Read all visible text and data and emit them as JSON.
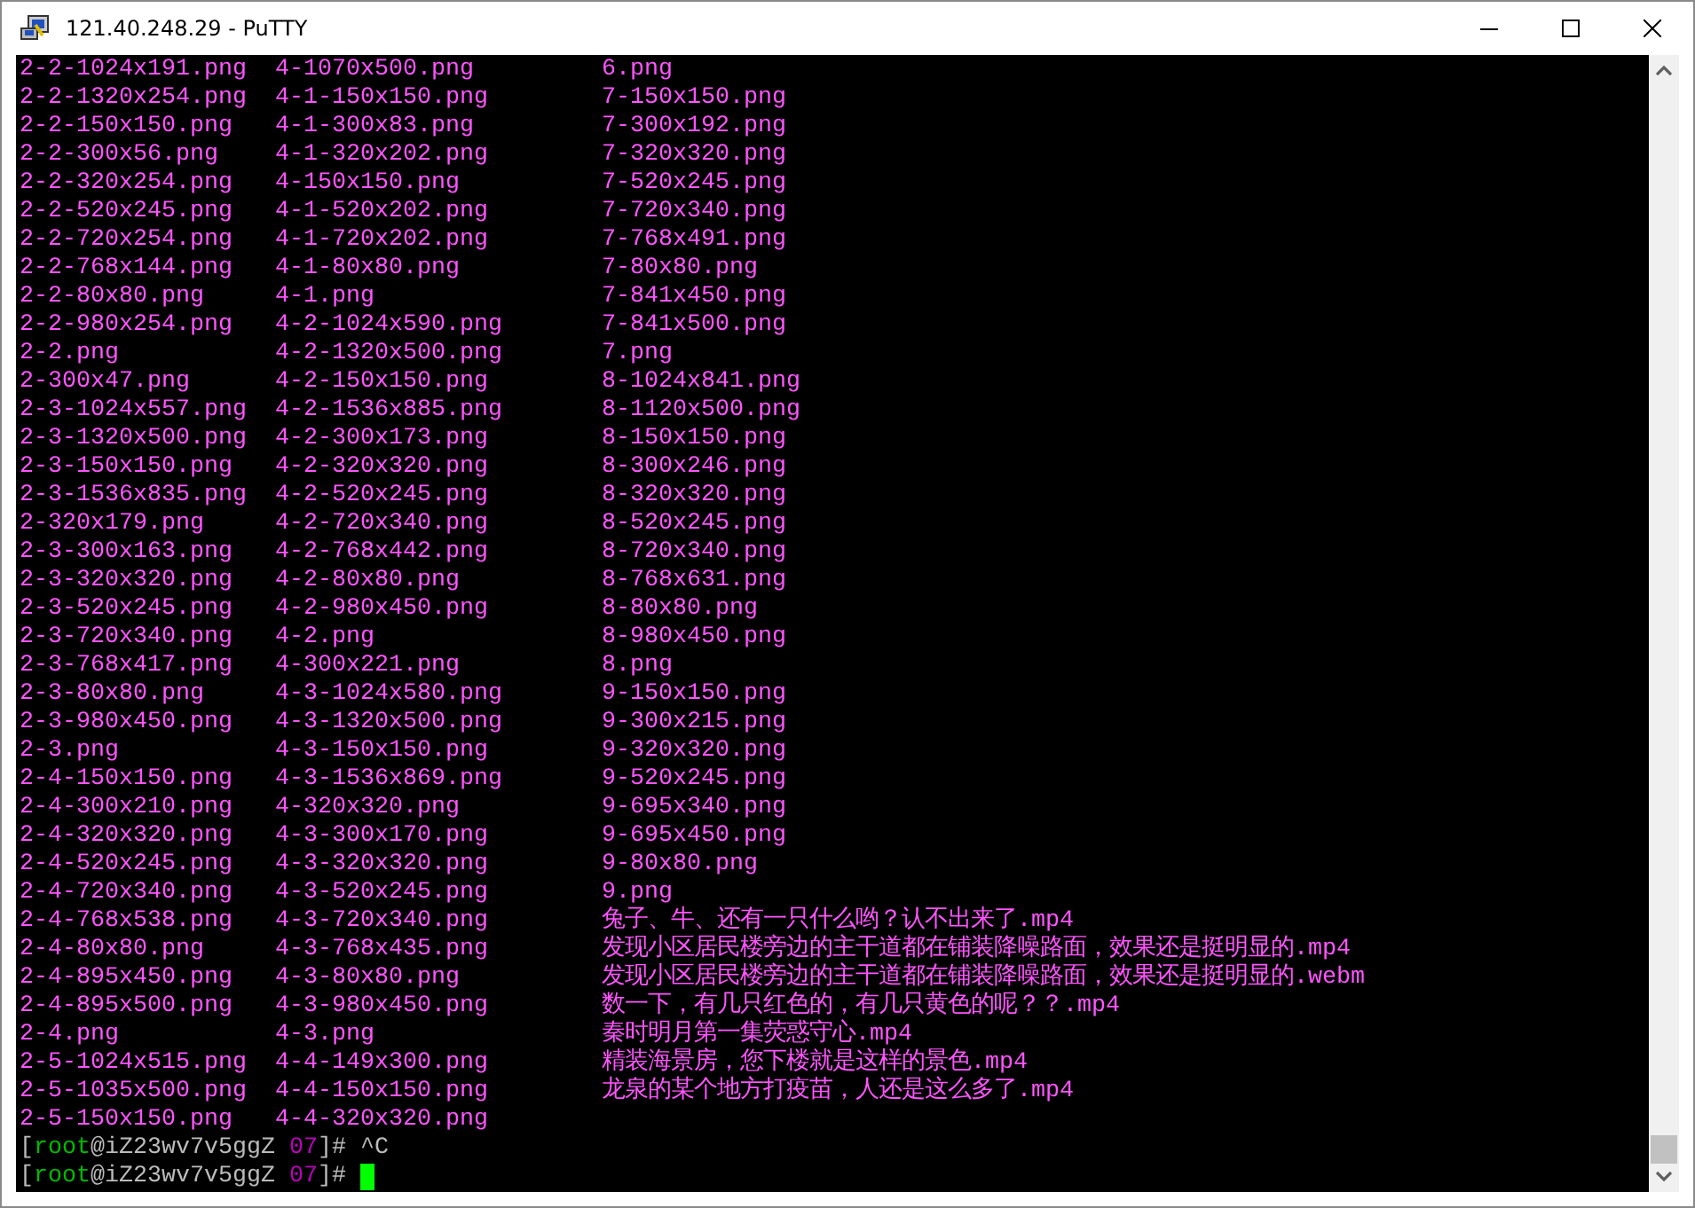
{
  "window": {
    "title": "121.40.248.29 - PuTTY"
  },
  "terminal": {
    "listing": [
      [
        "2-2-1024x191.png",
        "4-1070x500.png",
        "6.png"
      ],
      [
        "2-2-1320x254.png",
        "4-1-150x150.png",
        "7-150x150.png"
      ],
      [
        "2-2-150x150.png",
        "4-1-300x83.png",
        "7-300x192.png"
      ],
      [
        "2-2-300x56.png",
        "4-1-320x202.png",
        "7-320x320.png"
      ],
      [
        "2-2-320x254.png",
        "4-150x150.png",
        "7-520x245.png"
      ],
      [
        "2-2-520x245.png",
        "4-1-520x202.png",
        "7-720x340.png"
      ],
      [
        "2-2-720x254.png",
        "4-1-720x202.png",
        "7-768x491.png"
      ],
      [
        "2-2-768x144.png",
        "4-1-80x80.png",
        "7-80x80.png"
      ],
      [
        "2-2-80x80.png",
        "4-1.png",
        "7-841x450.png"
      ],
      [
        "2-2-980x254.png",
        "4-2-1024x590.png",
        "7-841x500.png"
      ],
      [
        "2-2.png",
        "4-2-1320x500.png",
        "7.png"
      ],
      [
        "2-300x47.png",
        "4-2-150x150.png",
        "8-1024x841.png"
      ],
      [
        "2-3-1024x557.png",
        "4-2-1536x885.png",
        "8-1120x500.png"
      ],
      [
        "2-3-1320x500.png",
        "4-2-300x173.png",
        "8-150x150.png"
      ],
      [
        "2-3-150x150.png",
        "4-2-320x320.png",
        "8-300x246.png"
      ],
      [
        "2-3-1536x835.png",
        "4-2-520x245.png",
        "8-320x320.png"
      ],
      [
        "2-320x179.png",
        "4-2-720x340.png",
        "8-520x245.png"
      ],
      [
        "2-3-300x163.png",
        "4-2-768x442.png",
        "8-720x340.png"
      ],
      [
        "2-3-320x320.png",
        "4-2-80x80.png",
        "8-768x631.png"
      ],
      [
        "2-3-520x245.png",
        "4-2-980x450.png",
        "8-80x80.png"
      ],
      [
        "2-3-720x340.png",
        "4-2.png",
        "8-980x450.png"
      ],
      [
        "2-3-768x417.png",
        "4-300x221.png",
        "8.png"
      ],
      [
        "2-3-80x80.png",
        "4-3-1024x580.png",
        "9-150x150.png"
      ],
      [
        "2-3-980x450.png",
        "4-3-1320x500.png",
        "9-300x215.png"
      ],
      [
        "2-3.png",
        "4-3-150x150.png",
        "9-320x320.png"
      ],
      [
        "2-4-150x150.png",
        "4-3-1536x869.png",
        "9-520x245.png"
      ],
      [
        "2-4-300x210.png",
        "4-320x320.png",
        "9-695x340.png"
      ],
      [
        "2-4-320x320.png",
        "4-3-300x170.png",
        "9-695x450.png"
      ],
      [
        "2-4-520x245.png",
        "4-3-320x320.png",
        "9-80x80.png"
      ],
      [
        "2-4-720x340.png",
        "4-3-520x245.png",
        "9.png"
      ],
      [
        "2-4-768x538.png",
        "4-3-720x340.png",
        "兔子、牛、还有一只什么哟？认不出来了.mp4"
      ],
      [
        "2-4-80x80.png",
        "4-3-768x435.png",
        "发现小区居民楼旁边的主干道都在铺装降噪路面，效果还是挺明显的.mp4"
      ],
      [
        "2-4-895x450.png",
        "4-3-80x80.png",
        "发现小区居民楼旁边的主干道都在铺装降噪路面，效果还是挺明显的.webm"
      ],
      [
        "2-4-895x500.png",
        "4-3-980x450.png",
        "数一下，有几只红色的，有几只黄色的呢？？.mp4"
      ],
      [
        "2-4.png",
        "4-3.png",
        "秦时明月第一集荧惑守心.mp4"
      ],
      [
        "2-5-1024x515.png",
        "4-4-149x300.png",
        "精装海景房，您下楼就是这样的景色.mp4"
      ],
      [
        "2-5-1035x500.png",
        "4-4-150x150.png",
        "龙泉的某个地方打疫苗，人还是这么多了.mp4"
      ],
      [
        "2-5-150x150.png",
        "4-4-320x320.png"
      ]
    ],
    "prompts": [
      {
        "segments": [
          {
            "kind": "punct",
            "text": "["
          },
          {
            "kind": "user",
            "text": "root"
          },
          {
            "kind": "punct",
            "text": "@iZ23wv7v5ggZ "
          },
          {
            "kind": "dir",
            "text": "07"
          },
          {
            "kind": "punct",
            "text": "]# "
          },
          {
            "kind": "command",
            "text": "^C"
          }
        ],
        "cursor": false
      },
      {
        "segments": [
          {
            "kind": "punct",
            "text": "["
          },
          {
            "kind": "user",
            "text": "root"
          },
          {
            "kind": "punct",
            "text": "@iZ23wv7v5ggZ "
          },
          {
            "kind": "dir",
            "text": "07"
          },
          {
            "kind": "punct",
            "text": "]# "
          }
        ],
        "cursor": true
      }
    ]
  }
}
